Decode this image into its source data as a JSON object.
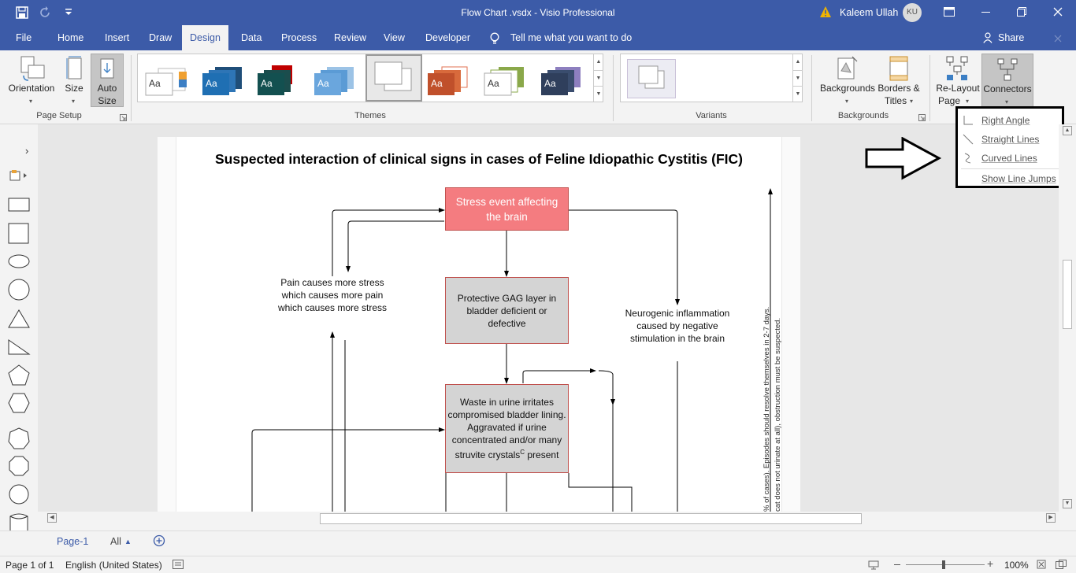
{
  "window": {
    "title": "Flow Chart .vsdx  -  Visio Professional",
    "user_name": "Kaleem Ullah",
    "user_initials": "KU"
  },
  "menu_tabs": [
    "File",
    "Home",
    "Insert",
    "Draw",
    "Design",
    "Data",
    "Process",
    "Review",
    "View",
    "Developer"
  ],
  "active_tab": "Design",
  "tell_me": "Tell me what you want to do",
  "share_label": "Share",
  "ribbon": {
    "page_setup": {
      "label": "Page Setup",
      "orientation": "Orientation",
      "size": "Size",
      "auto_size_line1": "Auto",
      "auto_size_line2": "Size"
    },
    "themes": {
      "label": "Themes",
      "thumb_text": "Aa"
    },
    "variants": {
      "label": "Variants"
    },
    "backgrounds": {
      "label": "Backgrounds",
      "backgrounds_btn": "Backgrounds",
      "borders_line1": "Borders &",
      "borders_line2": "Titles"
    },
    "layout": {
      "relayout_line1": "Re-Layout",
      "relayout_line2": "Page",
      "connectors": "Connectors"
    }
  },
  "connectors_menu": [
    "Right Angle",
    "Straight Lines",
    "Curved Lines",
    "Show Line Jumps"
  ],
  "diagram": {
    "title": "Suspected interaction of clinical signs in cases of Feline Idiopathic Cystitis (FIC)",
    "stress_event": "Stress event affecting the brain",
    "gag_layer": "Protective GAG layer in bladder deficient or defective",
    "waste_line1": "Waste in urine irritates compromised bladder lining. Aggravated if urine concentrated and/or many struvite crystals",
    "waste_sup": "C",
    "waste_line2": " present",
    "pain_text": "Pain causes more stress which causes more pain which causes more stress",
    "neuro_text": "Neurogenic inflammation caused by negative stimulation in the brain",
    "vertical_text1": "% of cases). Episodes should resolve themselves in 2-7 days.",
    "vertical_text2": "cat does not urinate at all), obstruction must be suspected."
  },
  "page_tabs": {
    "page1": "Page-1",
    "all": "All"
  },
  "status": {
    "page": "Page 1 of 1",
    "language": "English (United States)",
    "zoom": "100%"
  },
  "colors": {
    "accent": "#3c5ba8",
    "stress_fill": "#f47c80",
    "gray_fill": "#d4d4d4",
    "node_border": "#c0504d"
  }
}
